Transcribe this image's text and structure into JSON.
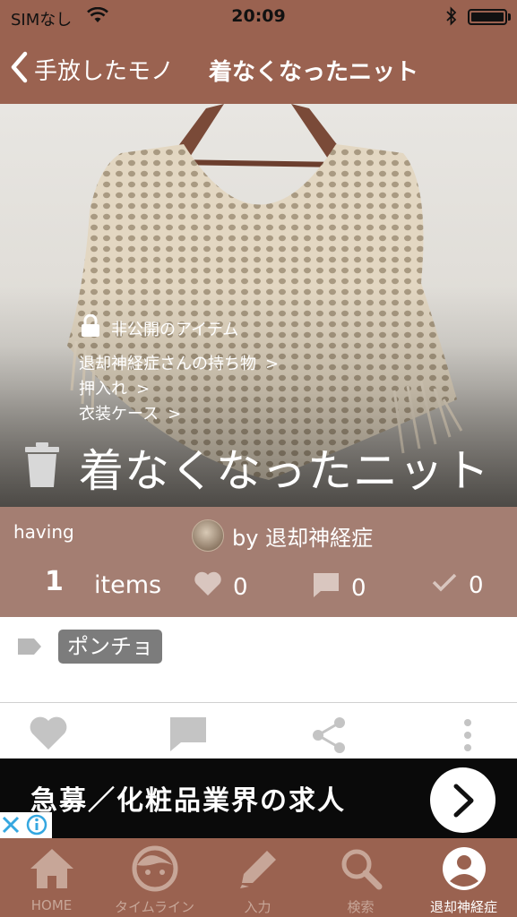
{
  "status_bar": {
    "carrier": "SIMなし",
    "time": "20:09"
  },
  "nav": {
    "back_label": "手放したモノ",
    "title": "着なくなったニット"
  },
  "item": {
    "private_label": "非公開のアイテム",
    "breadcrumbs": [
      "退却神経症さんの持ち物",
      "押入れ",
      "衣装ケース"
    ],
    "crumb_chevron": ">",
    "title": "着なくなったニット"
  },
  "stats": {
    "having_label": "having",
    "owner": "by 退却神経症",
    "count": "1",
    "items_label": "items",
    "likes": "0",
    "comments": "0",
    "checks": "0"
  },
  "tags": [
    "ポンチョ"
  ],
  "ad": {
    "text": "急募／化粧品業界の求人"
  },
  "tabs": [
    {
      "label": "HOME",
      "icon": "home-icon"
    },
    {
      "label": "タイムライン",
      "icon": "face-icon"
    },
    {
      "label": "入力",
      "icon": "pencil-icon"
    },
    {
      "label": "検索",
      "icon": "search-icon"
    },
    {
      "label": "退却神経症",
      "icon": "user-icon",
      "active": true
    }
  ],
  "colors": {
    "brand": "#9a6250",
    "stats_bg": "#a47e72",
    "tag_chip": "#7c7c7c",
    "inactive_tab": "#c7a698"
  }
}
